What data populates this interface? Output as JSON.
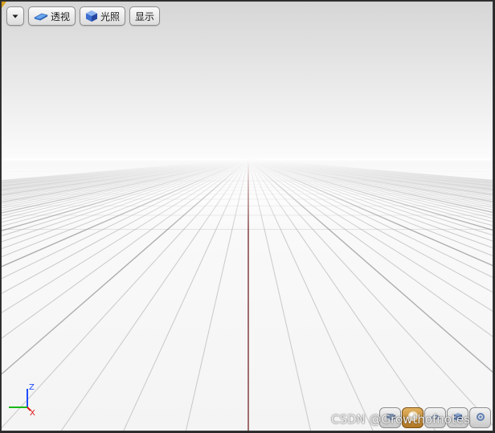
{
  "toolbar": {
    "menu_icon": "chevron-down-icon",
    "perspective_label": "透视",
    "perspective_icon": "perspective-plane-icon",
    "lighting_label": "光照",
    "lighting_icon": "lit-cube-icon",
    "show_label": "显示"
  },
  "axes": {
    "z_label": "Z",
    "x_label": "X",
    "colors": {
      "z": "#1e4cff",
      "x": "#e01010",
      "y": "#18b818"
    }
  },
  "nav_controls": [
    {
      "icon": "camera-back-icon"
    },
    {
      "icon": "orbit-sphere-icon",
      "active": true
    },
    {
      "icon": "camera-speed-icon"
    },
    {
      "icon": "frame-view-icon"
    },
    {
      "icon": "view-options-icon"
    }
  ],
  "watermark": "CSDN @Growthofnotes",
  "colors": {
    "accent_active": "#c48a2c",
    "grid_center": "#8b4a4a"
  }
}
